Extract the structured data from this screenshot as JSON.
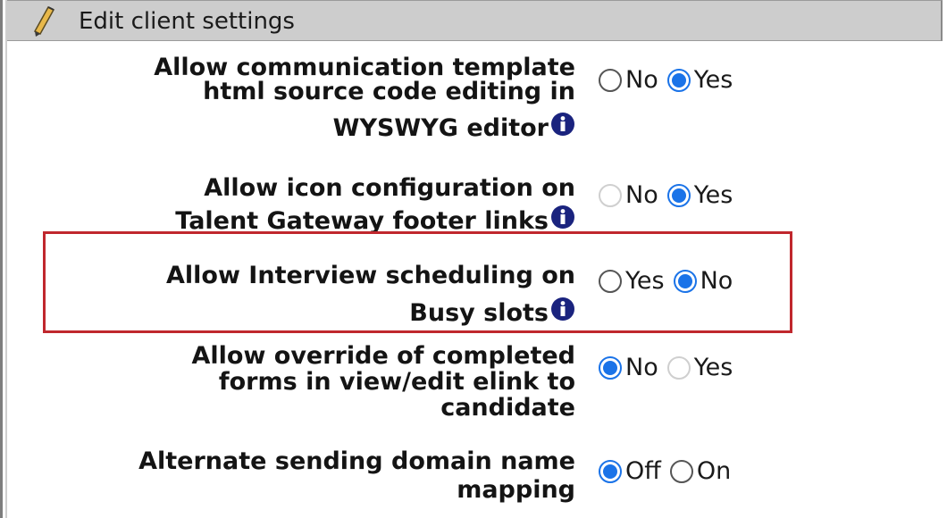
{
  "header": {
    "title": "Edit client settings",
    "icon": "pencil-icon"
  },
  "accent_color": "#1a73e8",
  "highlight_color": "#c0272d",
  "settings": [
    {
      "label_lines": [
        "Allow communication template",
        "html source code editing in",
        "WYSWYG editor"
      ],
      "options": [
        {
          "label": "No",
          "checked": false,
          "disabled": false
        },
        {
          "label": "Yes",
          "checked": true,
          "disabled": false
        }
      ]
    },
    {
      "label_lines": [
        "Allow icon configuration on",
        "Talent Gateway footer links"
      ],
      "options": [
        {
          "label": "No",
          "checked": false,
          "disabled": true
        },
        {
          "label": "Yes",
          "checked": true,
          "disabled": false
        }
      ]
    },
    {
      "label_lines": [
        "Allow Interview scheduling on",
        "Busy slots"
      ],
      "options": [
        {
          "label": "Yes",
          "checked": false,
          "disabled": false
        },
        {
          "label": "No",
          "checked": true,
          "disabled": false
        }
      ]
    },
    {
      "label_lines": [
        "Allow override of completed",
        "forms in view/edit elink to",
        "candidate"
      ],
      "options": [
        {
          "label": "No",
          "checked": true,
          "disabled": false
        },
        {
          "label": "Yes",
          "checked": false,
          "disabled": true
        }
      ]
    },
    {
      "label_lines": [
        "Alternate sending domain name",
        "mapping"
      ],
      "options": [
        {
          "label": "Off",
          "checked": true,
          "disabled": false
        },
        {
          "label": "On",
          "checked": false,
          "disabled": false
        }
      ]
    }
  ]
}
